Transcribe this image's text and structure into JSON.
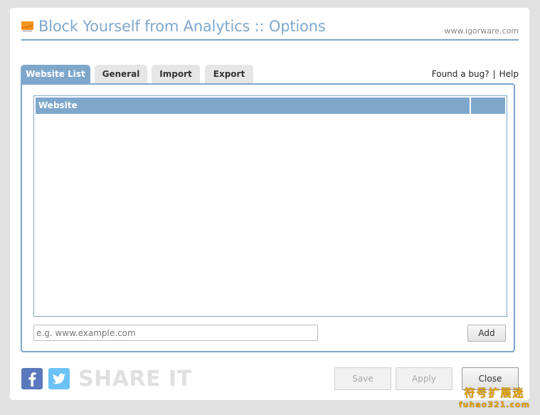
{
  "header": {
    "title": "Block Yourself from Analytics :: Options",
    "site_link": "www.igorware.com",
    "app_icon": "analytics-icon",
    "icon_label": "Analytics"
  },
  "tabs": [
    {
      "label": "Website List",
      "active": true
    },
    {
      "label": "General",
      "active": false
    },
    {
      "label": "Import",
      "active": false
    },
    {
      "label": "Export",
      "active": false
    }
  ],
  "top_links": {
    "bug": "Found a bug?",
    "separator": "|",
    "help": "Help"
  },
  "website_list": {
    "columns": [
      "Website",
      ""
    ],
    "rows": []
  },
  "add_form": {
    "input_value": "",
    "placeholder": "e.g. www.example.com",
    "add_label": "Add"
  },
  "share": {
    "facebook_icon": "facebook-icon",
    "twitter_icon": "twitter-icon",
    "text": "SHARE IT"
  },
  "footer_buttons": {
    "save": "Save",
    "apply": "Apply",
    "close": "Close"
  },
  "watermark": {
    "cn": "符号扩展迷",
    "url": "fuhao321.com"
  },
  "colors": {
    "accent": "#7fa7cc",
    "facebook": "#4a64a3",
    "twitter": "#55b3ef",
    "icon_orange": "#f7941d"
  }
}
